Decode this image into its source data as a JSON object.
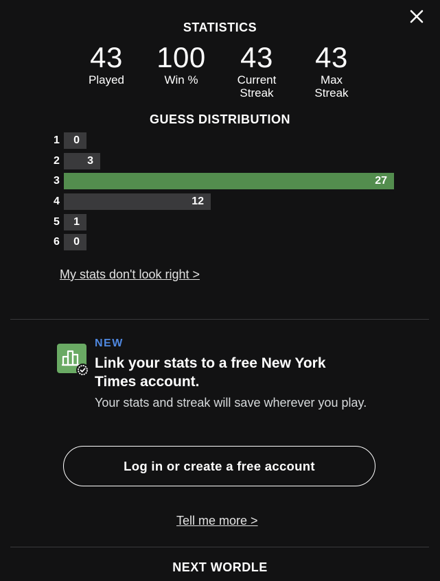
{
  "close_icon": "close-icon",
  "statistics": {
    "title": "STATISTICS",
    "items": [
      {
        "value": "43",
        "label": "Played"
      },
      {
        "value": "100",
        "label": "Win %"
      },
      {
        "value": "43",
        "label": "Current Streak"
      },
      {
        "value": "43",
        "label": "Max Streak"
      }
    ]
  },
  "distribution": {
    "title": "GUESS DISTRIBUTION",
    "highlight_color": "#538d4e",
    "bar_color": "#3a3a3c",
    "max_count": 27,
    "rows": [
      {
        "guess": "1",
        "count": 0
      },
      {
        "guess": "2",
        "count": 3
      },
      {
        "guess": "3",
        "count": 27,
        "highlight": true
      },
      {
        "guess": "4",
        "count": 12
      },
      {
        "guess": "5",
        "count": 1
      },
      {
        "guess": "6",
        "count": 0
      }
    ]
  },
  "stats_link": "My stats don't look right >",
  "promo": {
    "icon": "chart-icon",
    "badge_icon": "verified-check-icon",
    "tag": "NEW",
    "tag_color": "#4f88e0",
    "heading": "Link your stats to a free New York Times account.",
    "subtext": "Your stats and streak will save wherever you play.",
    "button_label": "Log in or create a free account",
    "more_link": "Tell me more >"
  },
  "next_wordle": {
    "title": "NEXT WORDLE"
  }
}
